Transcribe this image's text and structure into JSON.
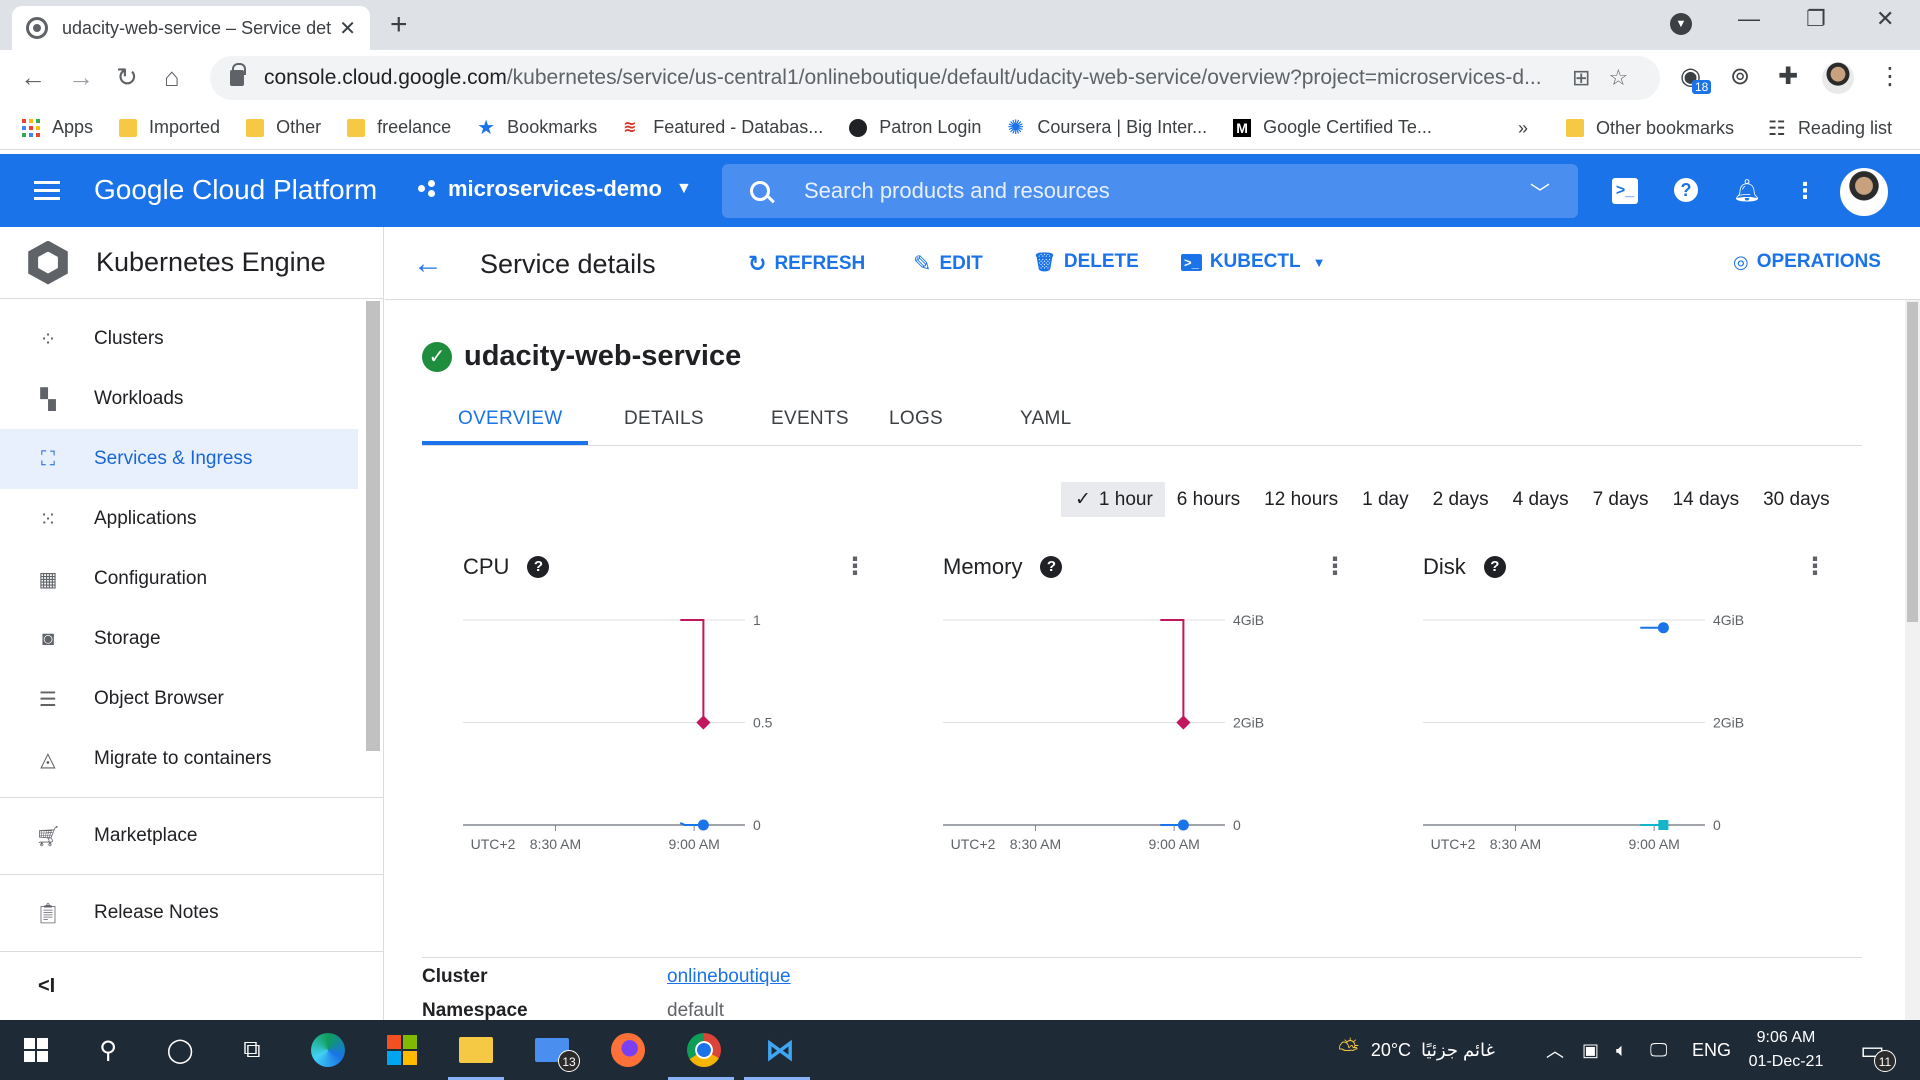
{
  "browser": {
    "tab_title": "udacity-web-service – Service det",
    "tab_close": "✕",
    "new_tab": "+",
    "url_main": "console.cloud.google.com",
    "url_path": "/kubernetes/service/us-central1/onlineboutique/default/udacity-web-service/overview?project=microservices-d...",
    "extension_badge": "18",
    "bookmarks": [
      {
        "label": "Apps",
        "icon": "apps-grid-icon"
      },
      {
        "label": "Imported",
        "icon": "folder-icon"
      },
      {
        "label": "Other",
        "icon": "folder-icon"
      },
      {
        "label": "freelance",
        "icon": "folder-icon"
      },
      {
        "label": "Bookmarks",
        "icon": "star-icon"
      },
      {
        "label": "Featured - Databas...",
        "icon": "red-logo-icon"
      },
      {
        "label": "Patron Login",
        "icon": "patron-icon"
      },
      {
        "label": "Coursera | Big Inter...",
        "icon": "coursera-icon"
      },
      {
        "label": "Google Certified Te...",
        "icon": "medium-icon"
      }
    ],
    "bookmarks_overflow": "»",
    "other_bookmarks": "Other bookmarks",
    "reading_list": "Reading list"
  },
  "header": {
    "title": "Google Cloud Platform",
    "project": "microservices-demo",
    "search_placeholder": "Search products and resources"
  },
  "sidenav": {
    "title": "Kubernetes Engine",
    "items": [
      {
        "label": "Clusters",
        "icon": "clusters-icon",
        "glyph": "⁘"
      },
      {
        "label": "Workloads",
        "icon": "workloads-icon",
        "glyph": "▚"
      },
      {
        "label": "Services & Ingress",
        "icon": "services-icon",
        "glyph": "⛶"
      },
      {
        "label": "Applications",
        "icon": "applications-icon",
        "glyph": "⁙"
      },
      {
        "label": "Configuration",
        "icon": "configuration-icon",
        "glyph": "▦"
      },
      {
        "label": "Storage",
        "icon": "storage-icon",
        "glyph": "◙"
      },
      {
        "label": "Object Browser",
        "icon": "object-browser-icon",
        "glyph": "☰"
      },
      {
        "label": "Migrate to containers",
        "icon": "migrate-icon",
        "glyph": "◬"
      }
    ],
    "marketplace": "Marketplace",
    "release_notes": "Release Notes",
    "collapse": "<I"
  },
  "page": {
    "title": "Service details",
    "actions": {
      "refresh": "REFRESH",
      "edit": "EDIT",
      "delete": "DELETE",
      "kubectl": "KUBECTL",
      "operations": "OPERATIONS"
    },
    "service_name": "udacity-web-service",
    "tabs": [
      "OVERVIEW",
      "DETAILS",
      "EVENTS",
      "LOGS",
      "YAML"
    ],
    "active_tab": "OVERVIEW",
    "time_ranges": [
      "1 hour",
      "6 hours",
      "12 hours",
      "1 day",
      "2 days",
      "4 days",
      "7 days",
      "14 days",
      "30 days"
    ],
    "selected_range": "1 hour",
    "properties": [
      {
        "key": "Cluster",
        "value": "onlineboutique",
        "link": true
      },
      {
        "key": "Namespace",
        "value": "default",
        "link": false
      }
    ]
  },
  "chart_data": [
    {
      "type": "line",
      "title": "CPU",
      "x_ticks": [
        "UTC+2",
        "8:30 AM",
        "9:00 AM"
      ],
      "y_ticks": [
        "0",
        "0.5",
        "1"
      ],
      "ylim": [
        0,
        1
      ],
      "series": [
        {
          "color": "#c2185b",
          "points": [
            [
              "8:57 AM",
              1
            ],
            [
              "9:02 AM",
              1
            ],
            [
              "9:02 AM",
              0.5
            ]
          ]
        },
        {
          "color": "#1a73e8",
          "points": [
            [
              "8:57 AM",
              0.01
            ],
            [
              "8:58 AM",
              0
            ],
            [
              "9:02 AM",
              0
            ]
          ]
        }
      ]
    },
    {
      "type": "line",
      "title": "Memory",
      "x_ticks": [
        "UTC+2",
        "8:30 AM",
        "9:00 AM"
      ],
      "y_ticks": [
        "0",
        "2GiB",
        "4GiB"
      ],
      "ylim": [
        0,
        4
      ],
      "series": [
        {
          "color": "#c2185b",
          "points": [
            [
              "8:57 AM",
              4
            ],
            [
              "9:02 AM",
              4
            ],
            [
              "9:02 AM",
              2
            ]
          ]
        },
        {
          "color": "#1a73e8",
          "points": [
            [
              "8:57 AM",
              0
            ],
            [
              "9:02 AM",
              0
            ]
          ]
        }
      ]
    },
    {
      "type": "line",
      "title": "Disk",
      "x_ticks": [
        "UTC+2",
        "8:30 AM",
        "9:00 AM"
      ],
      "y_ticks": [
        "0",
        "2GiB",
        "4GiB"
      ],
      "ylim": [
        0,
        4
      ],
      "series": [
        {
          "color": "#1a73e8",
          "points": [
            [
              "8:57 AM",
              3.85
            ],
            [
              "9:02 AM",
              3.85
            ]
          ]
        },
        {
          "color": "#12b5cb",
          "points": [
            [
              "8:57 AM",
              0
            ],
            [
              "9:02 AM",
              0
            ]
          ]
        }
      ]
    }
  ],
  "taskbar": {
    "weather_temp": "20°C",
    "weather_text": "غائم جزئيًا",
    "language": "ENG",
    "time": "9:06 AM",
    "date": "01-Dec-21",
    "mail_badge": "13",
    "notification_badge": "11"
  },
  "colors": {
    "brand_blue": "#1a73e8",
    "chart_magenta": "#c2185b",
    "chart_teal": "#12b5cb",
    "success_green": "#1e8e3e"
  }
}
